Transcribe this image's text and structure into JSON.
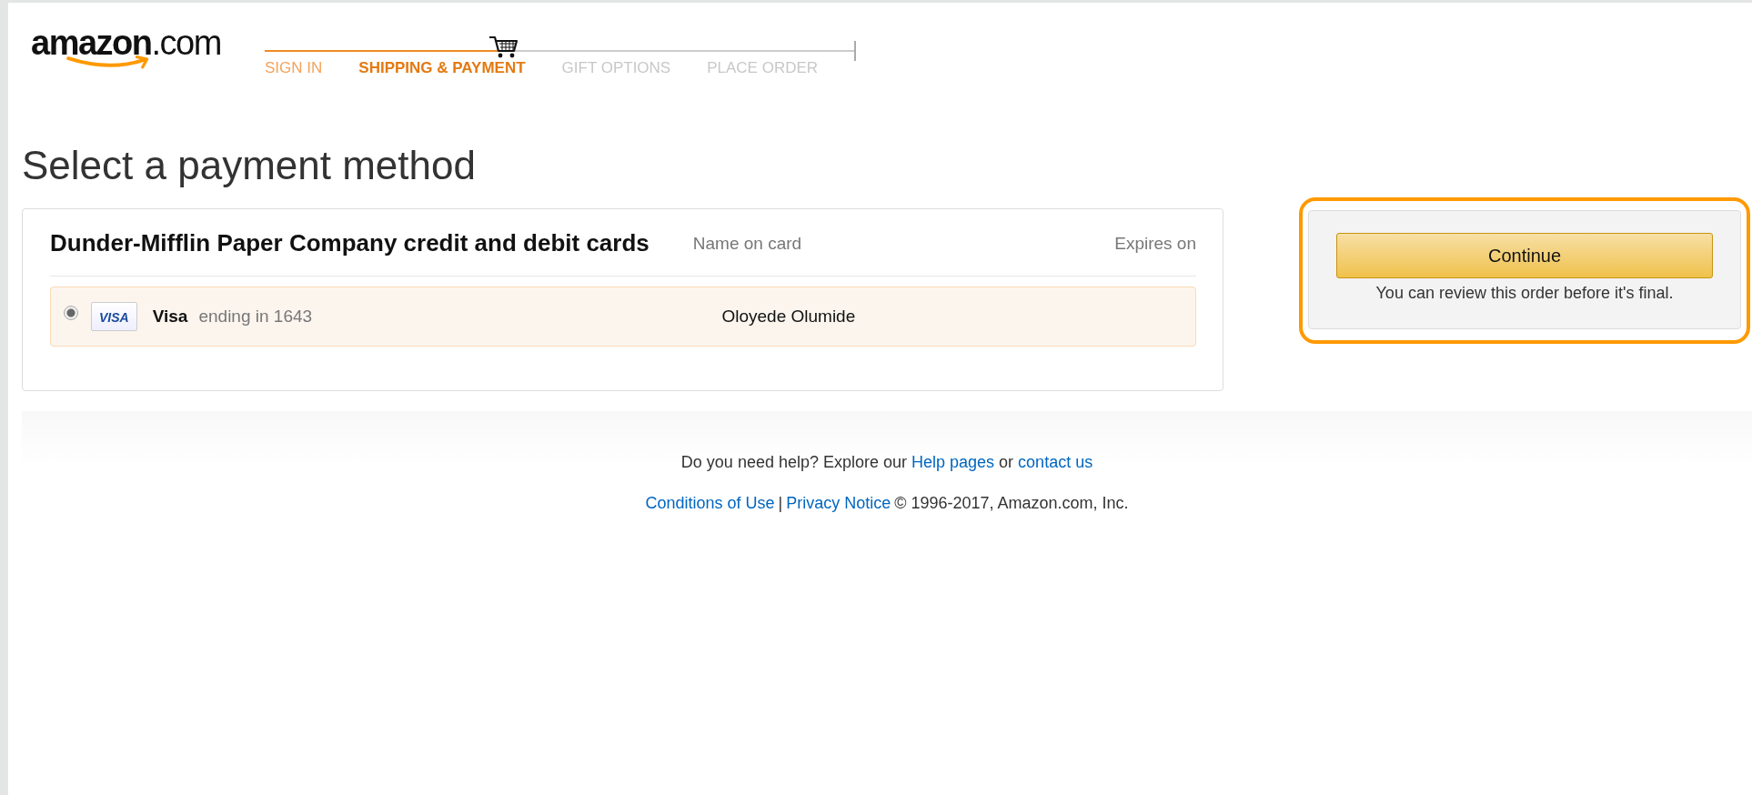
{
  "logo": {
    "name": "amazon",
    "suffix": ".com"
  },
  "checkout_steps": [
    {
      "label": "SIGN IN",
      "completed": true,
      "selected": false
    },
    {
      "label": "SHIPPING & PAYMENT",
      "completed": false,
      "selected": true
    },
    {
      "label": "GIFT OPTIONS",
      "completed": false,
      "selected": false
    },
    {
      "label": "PLACE ORDER",
      "completed": false,
      "selected": false
    }
  ],
  "page_title": "Select a payment method",
  "cards_panel": {
    "heading": "Dunder-Mifflin Paper Company credit and debit cards",
    "column_name": "Name on card",
    "column_expires": "Expires on",
    "cards": [
      {
        "brand_badge": "VISA",
        "brand": "Visa",
        "ending": "ending in 1643",
        "name_on_card": "Oloyede Olumide",
        "selected": true
      }
    ]
  },
  "continue_box": {
    "button": "Continue",
    "note": "You can review this order before it's final.",
    "highlighted": true
  },
  "footer": {
    "help_text": "Do you need help? Explore our",
    "help_link": "Help pages",
    "help_or": "or",
    "contact_link": "contact us",
    "legal_links": [
      "Conditions of Use",
      "Privacy Notice"
    ],
    "separator": "|",
    "copyright": "© 1996-2017, Amazon.com, Inc."
  }
}
